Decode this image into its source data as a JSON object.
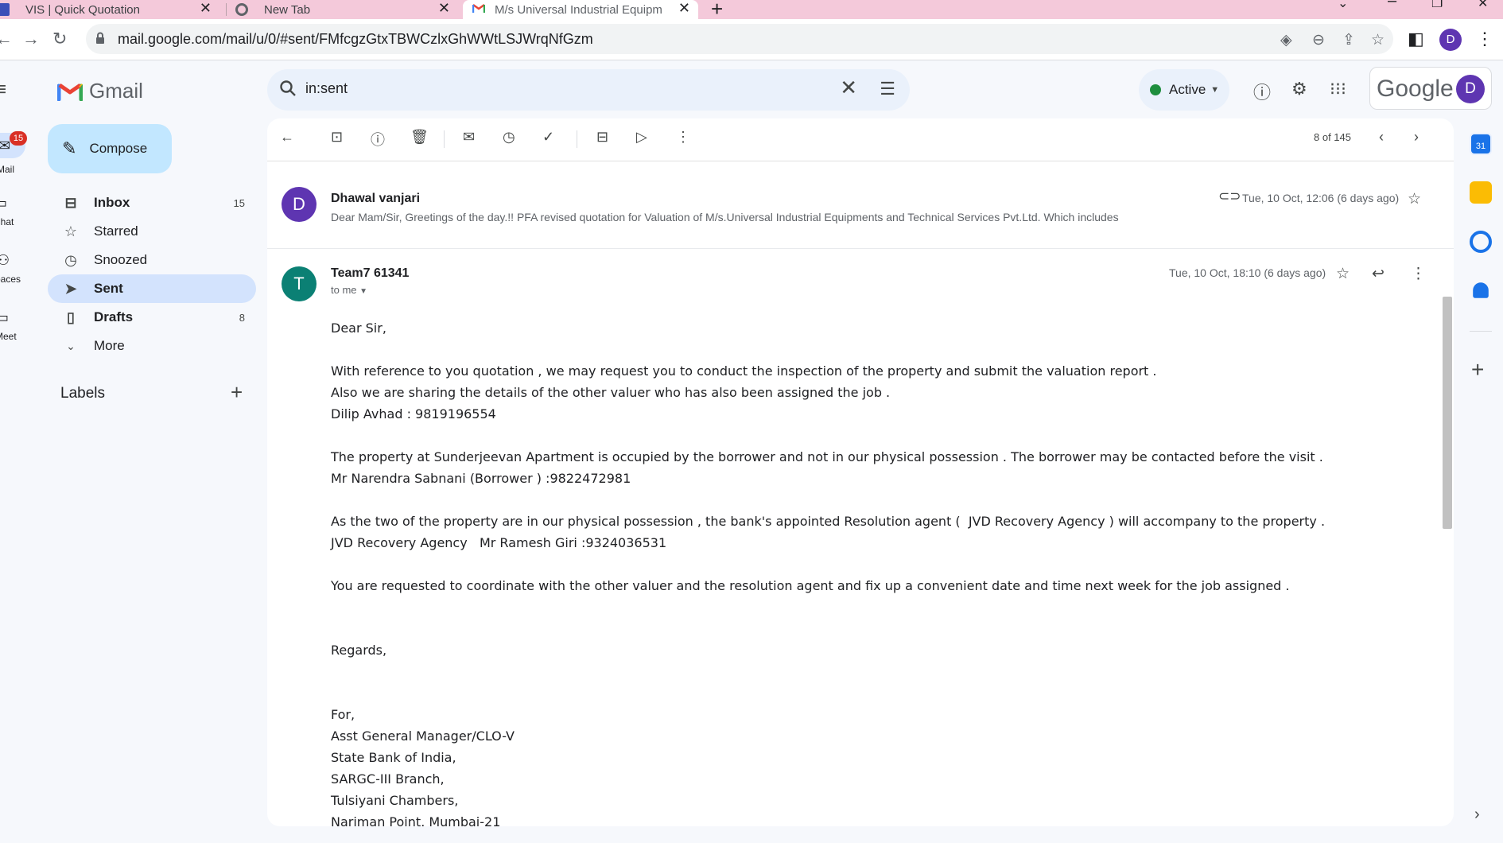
{
  "browser": {
    "tabs": [
      {
        "title": "VIS | Quick Quotation",
        "active": false
      },
      {
        "title": "New Tab",
        "active": false
      },
      {
        "title": "M/s Universal Industrial Equipm",
        "active": true
      }
    ],
    "url": "mail.google.com/mail/u/0/#sent/FMfcgzGtxTBWCzlxGhWWtLSJWrqNfGzm",
    "profile_initial": "D"
  },
  "rail": {
    "mail_label": "Mail",
    "mail_badge": "15",
    "chat_label": "Chat",
    "spaces_label": "Spaces",
    "meet_label": "Meet"
  },
  "gmail": {
    "logo_text": "Gmail",
    "compose_label": "Compose",
    "nav": [
      {
        "label": "Inbox",
        "count": "15"
      },
      {
        "label": "Starred",
        "count": ""
      },
      {
        "label": "Snoozed",
        "count": ""
      },
      {
        "label": "Sent",
        "count": ""
      },
      {
        "label": "Drafts",
        "count": "8"
      },
      {
        "label": "More",
        "count": ""
      }
    ],
    "labels_heading": "Labels"
  },
  "search": {
    "query": "in:sent"
  },
  "header": {
    "status": "Active",
    "brand_text": "Google",
    "avatar_initial": "D"
  },
  "toolbar": {
    "page_count": "8 of 145"
  },
  "thread": {
    "collapsed": {
      "avatar": "D",
      "avatar_color": "#5e35b1",
      "sender": "Dhawal vanjari",
      "snippet": "Dear Mam/Sir, Greetings of the day.!! PFA revised quotation for Valuation of M/s.Universal Industrial Equipments and Technical Services Pvt.Ltd. Which includes",
      "date": "Tue, 10 Oct, 12:06 (6 days ago)"
    },
    "expanded": {
      "avatar": "T",
      "avatar_color": "#0b8074",
      "sender": "Team7 61341",
      "to": "to me",
      "date": "Tue, 10 Oct, 18:10 (6 days ago)",
      "body_lines": [
        "Dear Sir,",
        "",
        "With reference to you quotation , we may request you to conduct the inspection of the property and submit the valuation report .",
        "Also we are sharing the details of the other valuer who has also been assigned the job .",
        "Dilip Avhad : 9819196554",
        "",
        "The property at Sunderjeevan Apartment is occupied by the borrower and not in our physical possession . The borrower may be contacted before the visit .",
        "Mr Narendra Sabnani (Borrower ) :9822472981",
        "",
        "As the two of the property are in our physical possession , the bank's appointed Resolution agent (  JVD Recovery Agency ) will accompany to the property .",
        "JVD Recovery Agency   Mr Ramesh Giri :9324036531",
        "",
        "You are requested to coordinate with the other valuer and the resolution agent and fix up a convenient date and time next week for the job assigned .",
        "",
        "",
        "Regards,",
        "",
        "",
        "For,",
        "Asst General Manager/CLO-V",
        "State Bank of India,",
        "SARGC-III Branch,",
        "Tulsiyani Chambers,",
        "Nariman Point, Mumbai-21"
      ]
    }
  },
  "sidepanel": {
    "calendar_day": "31"
  }
}
